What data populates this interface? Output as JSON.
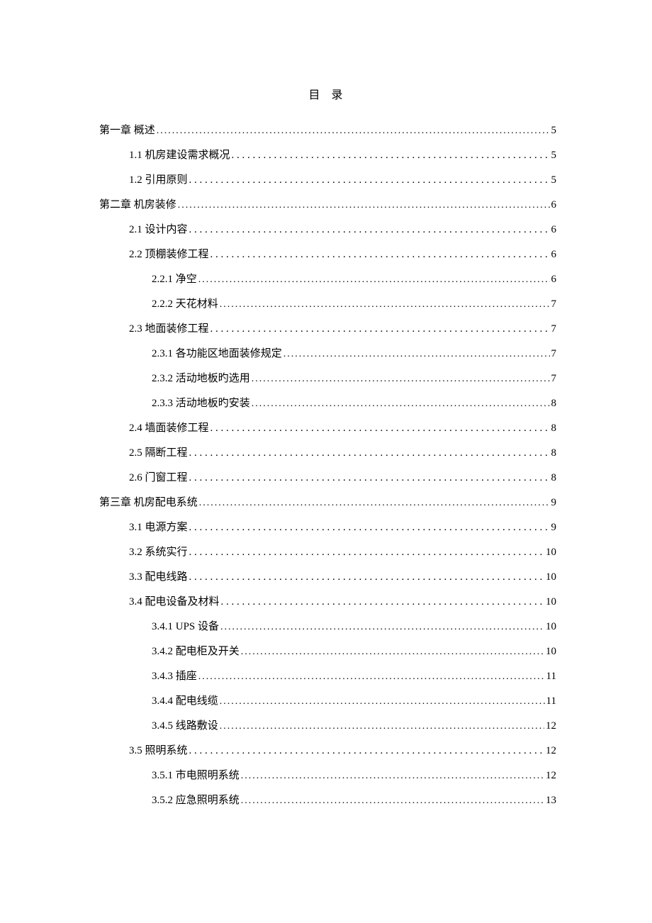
{
  "title": "目  录",
  "entries": [
    {
      "level": 1,
      "label": "第一章  概述",
      "page": "5",
      "leader": "dots"
    },
    {
      "level": 2,
      "label": "1.1 机房建设需求概况",
      "page": "5",
      "leader": "wide"
    },
    {
      "level": 2,
      "label": "1.2 引用原则",
      "page": "5",
      "leader": "wide"
    },
    {
      "level": 1,
      "label": "第二章  机房装修",
      "page": "6",
      "leader": "dots"
    },
    {
      "level": 2,
      "label": "2.1 设计内容",
      "page": "6",
      "leader": "wide"
    },
    {
      "level": 2,
      "label": "2.2 顶棚装修工程",
      "page": "6",
      "leader": "wide"
    },
    {
      "level": 3,
      "label": "2.2.1 净空",
      "page": "6",
      "leader": "dots",
      "numStyle": "ch"
    },
    {
      "level": 3,
      "label": "2.2.2 天花材料",
      "page": "7",
      "leader": "dots",
      "numStyle": "lat"
    },
    {
      "level": 2,
      "label": "2.3 地面装修工程",
      "page": "7",
      "leader": "wide"
    },
    {
      "level": 3,
      "label": "2.3.1 各功能区地面装修规定",
      "page": "7",
      "leader": "dots",
      "numStyle": "lat"
    },
    {
      "level": 3,
      "label": "2.3.2 活动地板旳选用",
      "page": "7",
      "leader": "dots",
      "numStyle": "lat"
    },
    {
      "level": 3,
      "label": "2.3.3 活动地板旳安装",
      "page": "8",
      "leader": "dots",
      "numStyle": "lat"
    },
    {
      "level": 2,
      "label": "2.4 墙面装修工程",
      "page": "8",
      "leader": "wide"
    },
    {
      "level": 2,
      "label": "2.5 隔断工程",
      "page": "8",
      "leader": "wide"
    },
    {
      "level": 2,
      "label": "2.6 门窗工程",
      "page": "8",
      "leader": "wide"
    },
    {
      "level": 1,
      "label": "第三章  机房配电系统",
      "page": "9",
      "leader": "dots"
    },
    {
      "level": 2,
      "label": "3.1 电源方案",
      "page": "9",
      "leader": "wide"
    },
    {
      "level": 2,
      "label": "3.2 系统实行",
      "page": "10",
      "leader": "wide"
    },
    {
      "level": 2,
      "label": "3.3 配电线路",
      "page": "10",
      "leader": "wide"
    },
    {
      "level": 2,
      "label": "3.4 配电设备及材料",
      "page": "10",
      "leader": "wide"
    },
    {
      "level": 3,
      "label": "3.4.1 UPS 设备",
      "page": "10",
      "leader": "dots",
      "numStyle": "lat"
    },
    {
      "level": 3,
      "label": "3.4.2  配电柜及开关",
      "page": "10",
      "leader": "dots",
      "numStyle": "lat"
    },
    {
      "level": 3,
      "label": "3.4.3  插座",
      "page": "11",
      "leader": "dots",
      "numStyle": "lat"
    },
    {
      "level": 3,
      "label": "3.4.4  配电线缆",
      "page": "11",
      "leader": "dots",
      "numStyle": "lat"
    },
    {
      "level": 3,
      "label": "3.4.5  线路敷设",
      "page": "12",
      "leader": "dots",
      "numStyle": "lat"
    },
    {
      "level": 2,
      "label": "3.5 照明系统",
      "page": "12",
      "leader": "wide"
    },
    {
      "level": 3,
      "label": "3.5.1  市电照明系统",
      "page": "12",
      "leader": "dots",
      "numStyle": "lat"
    },
    {
      "level": 3,
      "label": "3.5.2  应急照明系统",
      "page": "13",
      "leader": "dots",
      "numStyle": "lat"
    }
  ]
}
